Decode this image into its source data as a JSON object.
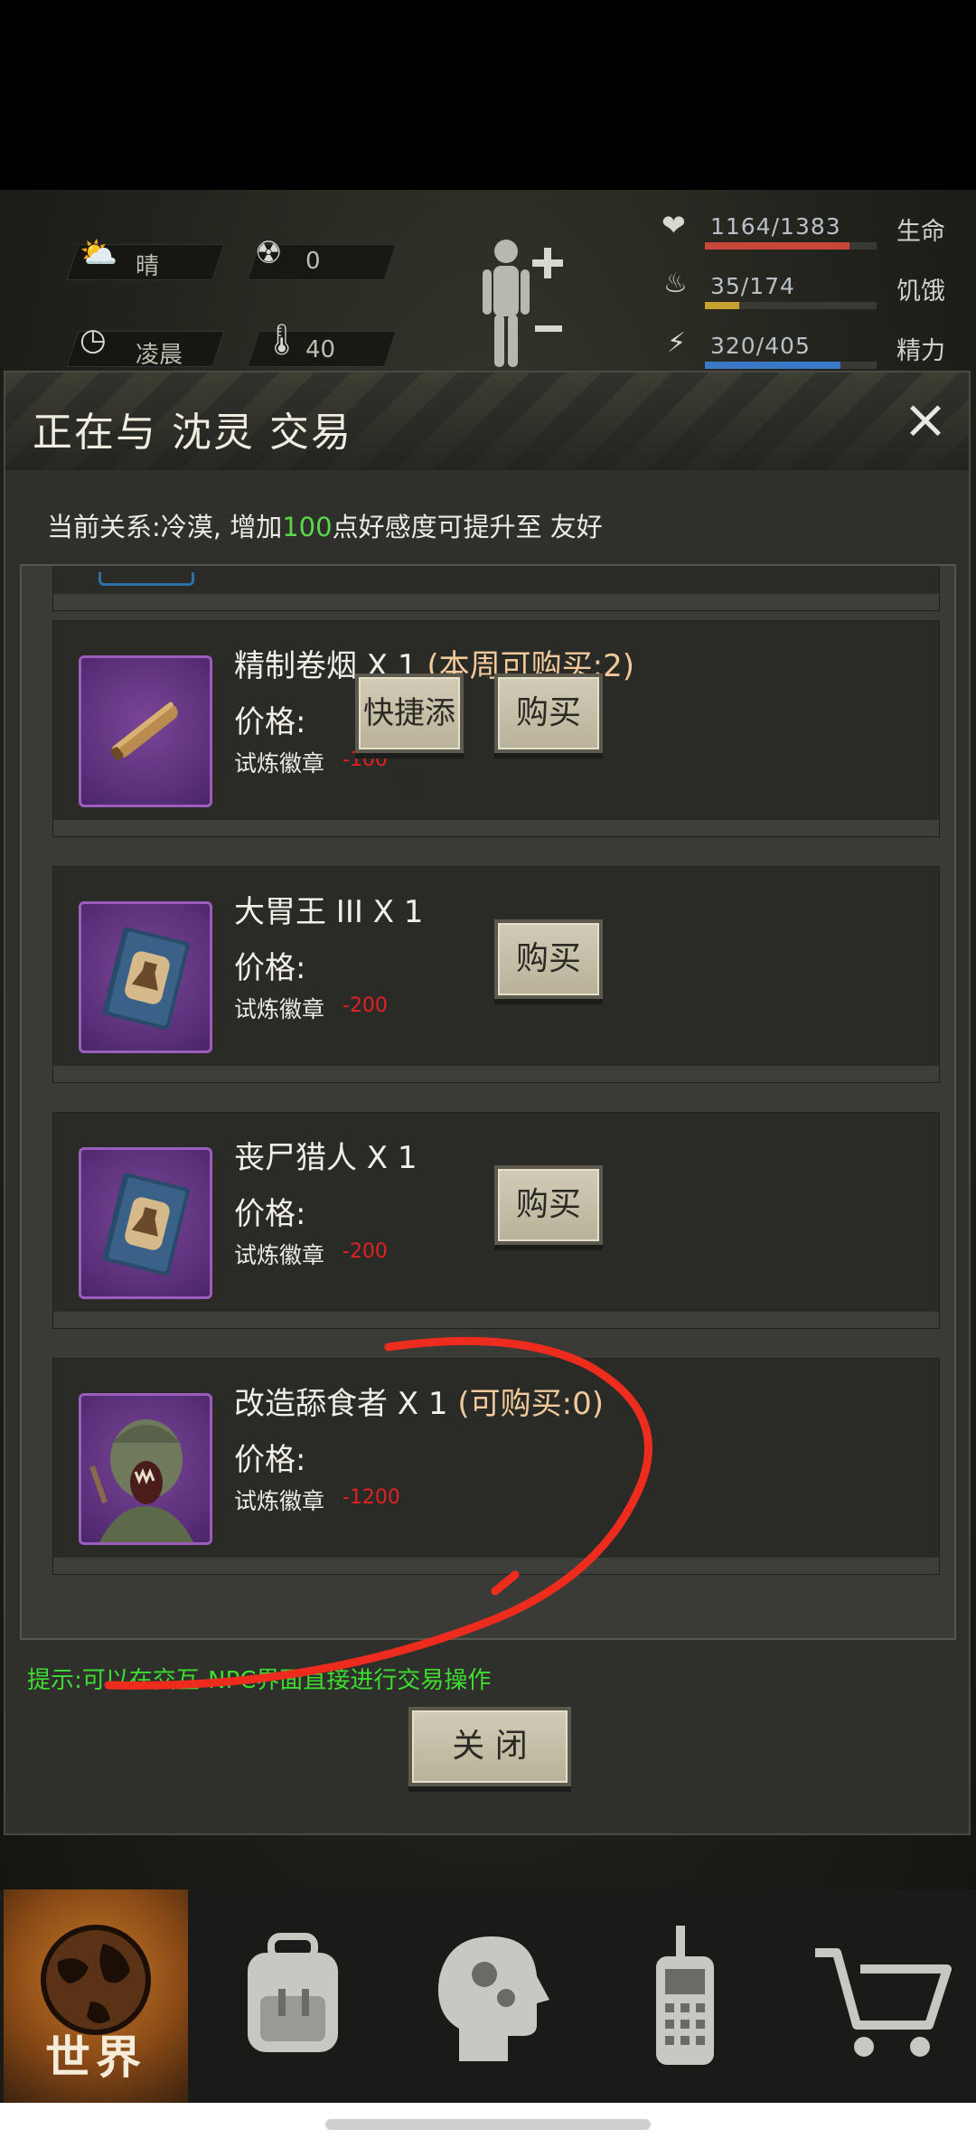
{
  "hud": {
    "weather": "晴",
    "radiation": "0",
    "time_of_day": "凌晨",
    "temperature": "40",
    "stats": [
      {
        "name": "生命",
        "value": "1164/1383",
        "fraction": 0.842,
        "color": "#c8463a"
      },
      {
        "name": "饥饿",
        "value": "35/174",
        "fraction": 0.201,
        "color": "#c8a030"
      },
      {
        "name": "精力",
        "value": "320/405",
        "fraction": 0.79,
        "color": "#3a78c8"
      }
    ]
  },
  "dialog": {
    "title": "正在与 沈灵 交易",
    "relation_prefix": "当前关系:冷漠, 增加",
    "relation_points": "100",
    "relation_suffix": "点好感度可提升至 友好",
    "price_label": "价格:",
    "quick_add_label": "快捷添加",
    "buy_label": "购买",
    "items": [
      {
        "name": "精制卷烟 X 1",
        "limit": "(本周可购买:2)",
        "currency": "试炼徽章",
        "price": "-100",
        "has_quick_add": true,
        "has_buy": true,
        "icon": "cigar-icon"
      },
      {
        "name": "大胃王 III X 1",
        "limit": "",
        "currency": "试炼徽章",
        "price": "-200",
        "has_quick_add": false,
        "has_buy": true,
        "icon": "book-icon"
      },
      {
        "name": "丧尸猎人 X 1",
        "limit": "",
        "currency": "试炼徽章",
        "price": "-200",
        "has_quick_add": false,
        "has_buy": true,
        "icon": "book-icon"
      },
      {
        "name": "改造舔食者 X 1",
        "limit": "(可购买:0)",
        "currency": "试炼徽章",
        "price": "-1200",
        "has_quick_add": false,
        "has_buy": false,
        "icon": "licker-icon"
      }
    ],
    "hint": "提示:可以在交互-NPC界面直接进行交易操作",
    "close_label": "关 闭"
  },
  "nav": {
    "items": [
      {
        "label": "世界",
        "icon": "globe-icon",
        "active": true
      },
      {
        "label": "",
        "icon": "backpack-icon",
        "active": false
      },
      {
        "label": "",
        "icon": "skills-head-icon",
        "active": false
      },
      {
        "label": "",
        "icon": "radio-icon",
        "active": false
      },
      {
        "label": "",
        "icon": "cart-icon",
        "active": false
      }
    ]
  },
  "colors": {
    "price_red": "#e02222",
    "relation_green": "#5ad84a",
    "hint_green": "#3dde30",
    "limit_orange": "#f1c99a"
  }
}
